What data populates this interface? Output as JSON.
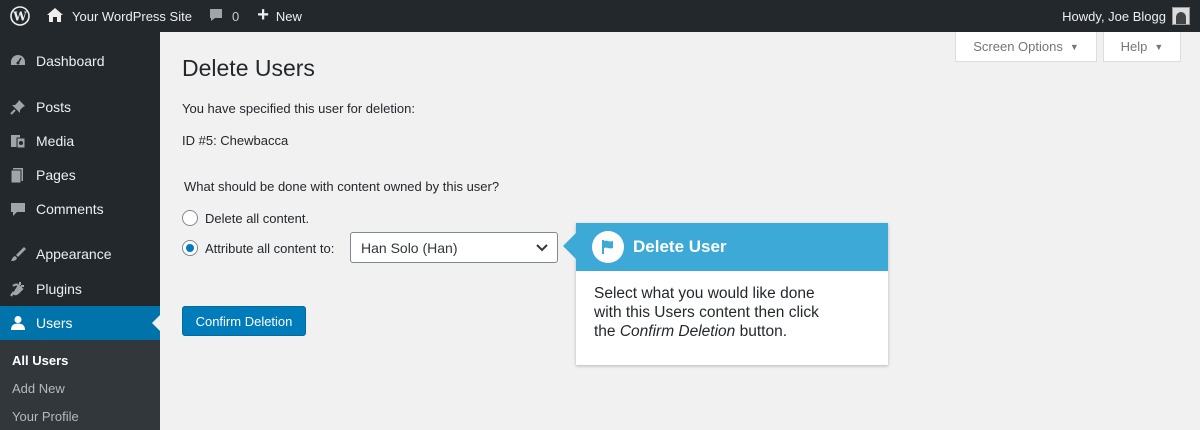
{
  "admin_bar": {
    "site_name": "Your WordPress Site",
    "comments_count": "0",
    "new_label": "New",
    "greeting": "Howdy, Joe Blogg"
  },
  "sidebar": {
    "items": [
      {
        "label": "Dashboard",
        "icon": "dashboard-icon"
      },
      {
        "label": "Posts",
        "icon": "pushpin-icon"
      },
      {
        "label": "Media",
        "icon": "media-icon"
      },
      {
        "label": "Pages",
        "icon": "pages-icon"
      },
      {
        "label": "Comments",
        "icon": "comment-icon"
      },
      {
        "label": "Appearance",
        "icon": "paintbrush-icon"
      },
      {
        "label": "Plugins",
        "icon": "plugin-icon"
      },
      {
        "label": "Users",
        "icon": "user-icon",
        "current": true
      }
    ],
    "submenu": [
      {
        "label": "All Users",
        "active": true
      },
      {
        "label": "Add New"
      },
      {
        "label": "Your Profile"
      }
    ]
  },
  "screen_options": {
    "label": "Screen Options"
  },
  "help": {
    "label": "Help"
  },
  "main": {
    "title": "Delete Users",
    "intro": "You have specified this user for deletion:",
    "user_id": "ID #5: Chewbacca",
    "question": "What should be done with content owned by this user?",
    "option_delete": "Delete all content.",
    "option_attribute": "Attribute all content to:",
    "attribute_value": "Han Solo (Han)",
    "confirm_button": "Confirm Deletion"
  },
  "tooltip": {
    "title": "Delete User",
    "body_line1": "Select what you would like done",
    "body_line2": "with this Users content then click",
    "body_line3_prefix": "the ",
    "body_line3_em": "Confirm Deletion",
    "body_line3_suffix": " button."
  },
  "colors": {
    "admin_bar": "#23282d",
    "accent": "#0073aa",
    "tooltip_header": "#3da9d6",
    "background": "#f1f1f1"
  }
}
